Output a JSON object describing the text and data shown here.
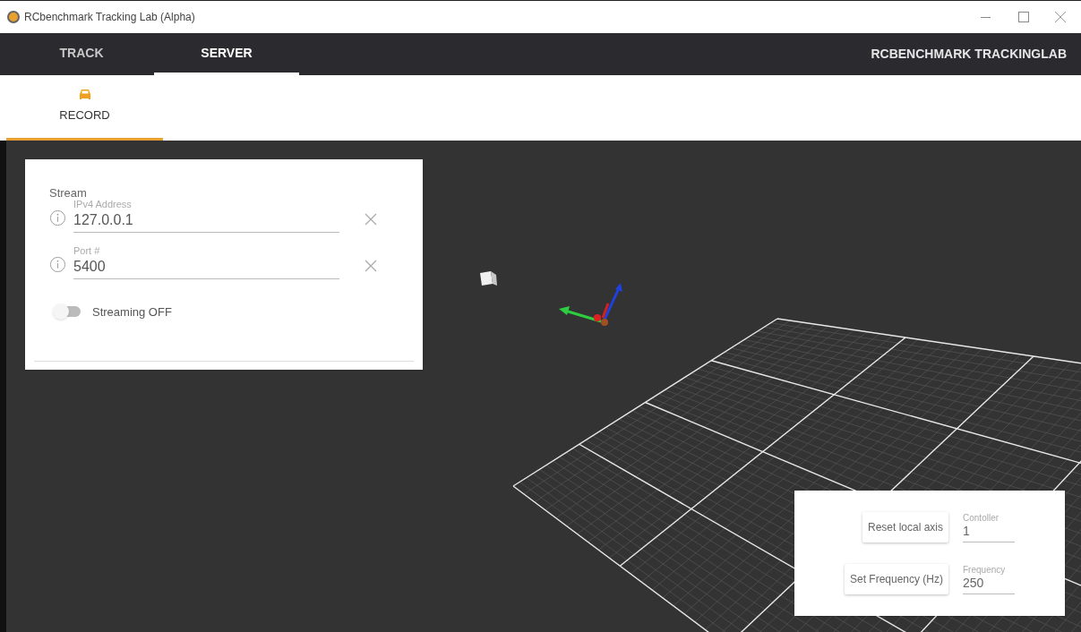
{
  "window": {
    "title": "RCbenchmark Tracking Lab (Alpha)"
  },
  "nav": {
    "tabs": [
      {
        "label": "TRACK",
        "selected": false
      },
      {
        "label": "SERVER",
        "selected": true
      }
    ],
    "brand": "RCBENCHMARK TRACKINGLAB"
  },
  "subtabs": [
    {
      "label": "RECORD",
      "selected": true
    }
  ],
  "stream_panel": {
    "title": "Stream",
    "fields": [
      {
        "label": "IPv4 Address",
        "value": "127.0.0.1"
      },
      {
        "label": "Port #",
        "value": "5400"
      }
    ],
    "toggle": {
      "label": "Streaming OFF",
      "on": false
    }
  },
  "control_panel": {
    "buttons": [
      "Reset local axis",
      "Set Frequency (Hz)"
    ],
    "fields": [
      {
        "label": "Contoller",
        "value": "1"
      },
      {
        "label": "Frequency",
        "value": "250"
      }
    ]
  }
}
